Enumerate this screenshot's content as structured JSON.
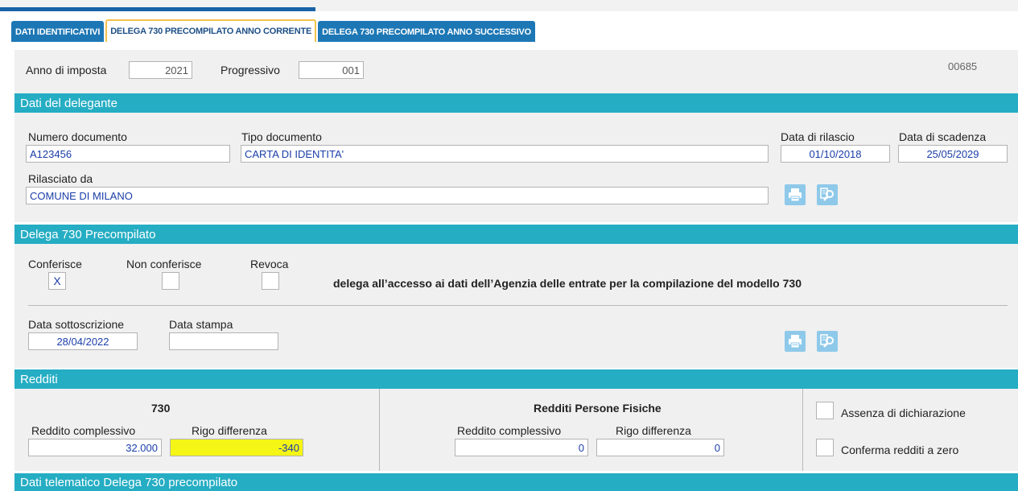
{
  "tabs": [
    {
      "label": "DATI IDENTIFICATIVI"
    },
    {
      "label": "DELEGA 730 PRECOMPILATO ANNO CORRENTE"
    },
    {
      "label": "DELEGA 730 PRECOMPILATO ANNO SUCCESSIVO"
    }
  ],
  "top": {
    "anno_label": "Anno di imposta",
    "anno_value": "2021",
    "progressivo_label": "Progressivo",
    "progressivo_value": "001",
    "code": "00685"
  },
  "delegante": {
    "header": "Dati del delegante",
    "numero_label": "Numero documento",
    "numero_value": "A123456",
    "tipo_label": "Tipo documento",
    "tipo_value": "CARTA DI IDENTITA'",
    "rilascio_label": "Data di rilascio",
    "rilascio_value": "01/10/2018",
    "scadenza_label": "Data di scadenza",
    "scadenza_value": "25/05/2029",
    "rilasciato_label": "Rilasciato da",
    "rilasciato_value": "COMUNE DI MILANO"
  },
  "delega": {
    "header": "Delega 730 Precompilato",
    "conferisce_label": "Conferisce",
    "conferisce_value": "X",
    "non_conferisce_label": "Non conferisce",
    "non_conferisce_value": "",
    "revoca_label": "Revoca",
    "revoca_value": "",
    "description": "delega all’accesso ai dati dell’Agenzia delle entrate per la compilazione del modello 730",
    "sottoscrizione_label": "Data sottoscrizione",
    "sottoscrizione_value": "28/04/2022",
    "stampa_label": "Data stampa",
    "stampa_value": ""
  },
  "redditi": {
    "header": "Redditi",
    "col730_title": "730",
    "col730_reddito_label": "Reddito complessivo",
    "col730_reddito_value": "32.000",
    "col730_rigo_label": "Rigo differenza",
    "col730_rigo_value": "-340",
    "rpf_title": "Redditi Persone Fisiche",
    "rpf_reddito_label": "Reddito complessivo",
    "rpf_reddito_value": "0",
    "rpf_rigo_label": "Rigo differenza",
    "rpf_rigo_value": "0",
    "assenza_label": "Assenza di dichiarazione",
    "conferma_label": "Conferma redditi a zero"
  },
  "telematico": {
    "header": "Dati telematico Delega 730 precompilato"
  },
  "icons": {
    "print": "print-icon",
    "preview": "preview-icon"
  }
}
